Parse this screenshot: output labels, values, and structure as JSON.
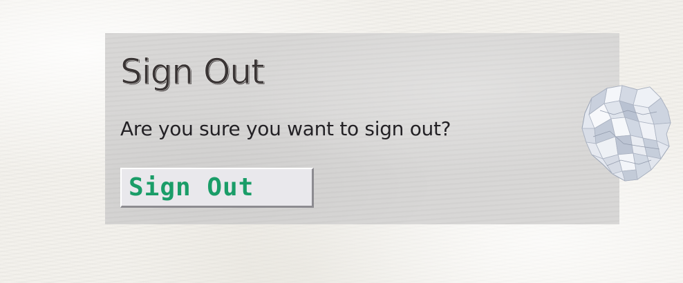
{
  "dialog": {
    "title": "Sign Out",
    "message": "Are you sure you want to sign out?",
    "confirm_label": "Sign Out"
  },
  "decoration": {
    "icon": "crumpled-paper-icon"
  },
  "colors": {
    "page_background": "#f3f1ec",
    "card_background": "#d7d6d5",
    "title_text": "#3a3535",
    "message_text": "#232125",
    "button_background": "#e9e8ec",
    "button_text": "#1a9d68"
  }
}
